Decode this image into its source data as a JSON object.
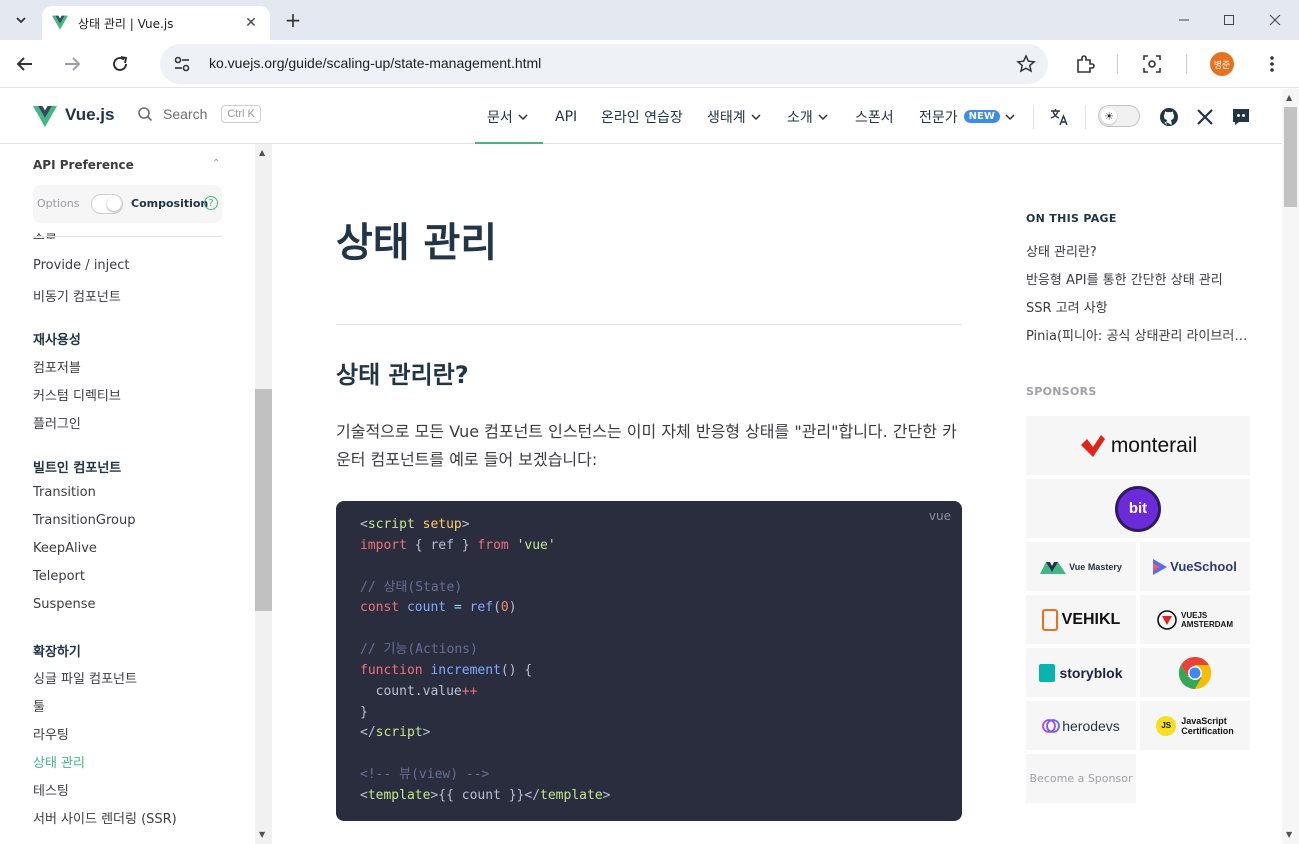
{
  "browser": {
    "tab_title": "상태 관리 | Vue.js",
    "url": "ko.vuejs.org/guide/scaling-up/state-management.html",
    "profile_initials": "병준"
  },
  "nav": {
    "logo_text": "Vue.js",
    "search_label": "Search",
    "search_kbd": "Ctrl K",
    "menu": {
      "docs": "문서",
      "api": "API",
      "playground": "온라인 연습장",
      "ecosystem": "생태계",
      "about": "소개",
      "sponsor": "스폰서",
      "experts": "전문가",
      "new_badge": "NEW"
    }
  },
  "sidebar": {
    "api_pref_title": "API Preference",
    "options_label": "Options",
    "composition_label": "Composition",
    "help": "?",
    "cut_item": "슬롯",
    "items_top": [
      "Provide / inject",
      "비동기 컴포넌트"
    ],
    "section_reuse": "재사용성",
    "items_reuse": [
      "컴포저블",
      "커스텀 디렉티브",
      "플러그인"
    ],
    "section_builtin": "빌트인 컴포넌트",
    "items_builtin": [
      "Transition",
      "TransitionGroup",
      "KeepAlive",
      "Teleport",
      "Suspense"
    ],
    "section_scaling": "확장하기",
    "items_scaling": [
      "싱글 파일 컴포넌트",
      "툴",
      "라우팅",
      "상태 관리",
      "테스팅",
      "서버 사이드 렌더링 (SSR)"
    ]
  },
  "content": {
    "h1": "상태 관리",
    "h2": "상태 관리란?",
    "para": "기술적으로 모든 Vue 컴포넌트 인스턴스는 이미 자체 반응형 상태를 \"관리\"합니다. 간단한 카운터 컴포넌트를 예로 들어 보겠습니다:",
    "code_lang": "vue",
    "code": {
      "l1_tag": "script",
      "l1_attr": "setup",
      "l2_import": "import",
      "l2_mid": " { ref } ",
      "l2_from": "from",
      "l2_str": "'vue'",
      "l4_comment": "// 상태(State)",
      "l5_const": "const",
      "l5_var": "count",
      "l5_eq": "=",
      "l5_fn": "ref",
      "l5_num": "0",
      "l7_comment": "// 기능(Actions)",
      "l8_function": "function",
      "l8_fn": "increment",
      "l8_rest": "() {",
      "l9_a": "count.value",
      "l9_op": "++",
      "l10": "}",
      "l11_tag": "script",
      "l13_comment": "<!-- 뷰(view) -->",
      "l14_tag": "template",
      "l14_mid": "{{ count }}"
    }
  },
  "aside": {
    "on_this_page": "ON THIS PAGE",
    "links": [
      "상태 관리란?",
      "반응형 API를 통한 간단한 상태 관리",
      "SSR 고려 사항",
      "Pinia(피니아: 공식 상태관리 라이브러리)"
    ],
    "sponsors_title": "SPONSORS",
    "sponsors": {
      "monterail": "monterail",
      "bit": "bit",
      "vuemastery": "Vue Mastery",
      "vueschool": "VueSchool",
      "vehikl": "VEHIKL",
      "vuejs_amsterdam_1": "VUEJS",
      "vuejs_amsterdam_2": "AMSTERDAM",
      "storyblok": "storyblok",
      "herodevs": "herodevs",
      "js_badge": "JS",
      "js_cert_1": "JavaScript",
      "js_cert_2": "Certification",
      "become": "Become a Sponsor"
    }
  },
  "colors": {
    "brand": "#42b883",
    "code_bg": "#292d3e",
    "heading": "#213547"
  }
}
